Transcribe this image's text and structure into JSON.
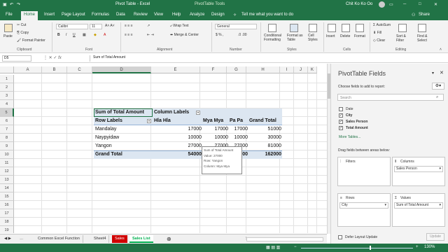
{
  "titlebar": {
    "doc_title": "Pivot Table - Excel",
    "tools_label": "PivotTable Tools",
    "user": "Chit Ko Ko Oo"
  },
  "ribbon_tabs": [
    "File",
    "Home",
    "Insert",
    "Page Layout",
    "Formulas",
    "Data",
    "Review",
    "View",
    "Help",
    "Analyze",
    "Design"
  ],
  "tell_me": "Tell me what you want to do",
  "share": "Share",
  "clipboard": {
    "paste": "Paste",
    "cut": "Cut",
    "copy": "Copy",
    "format_painter": "Format Painter",
    "group": "Clipboard"
  },
  "font": {
    "name": "Calibri",
    "size": "11",
    "group": "Font"
  },
  "alignment": {
    "wrap": "Wrap Text",
    "merge": "Merge & Center",
    "group": "Alignment"
  },
  "number": {
    "format": "General",
    "group": "Number"
  },
  "styles": {
    "conditional": "Conditional Formatting",
    "format_table": "Format as Table",
    "cell_styles": "Cell Styles",
    "group": "Styles"
  },
  "cells": {
    "insert": "Insert",
    "delete": "Delete",
    "format": "Format",
    "group": "Cells"
  },
  "editing": {
    "autosum": "AutoSum",
    "fill": "Fill",
    "clear": "Clear",
    "sort": "Sort & Filter",
    "find": "Find & Select",
    "group": "Editing"
  },
  "formula_bar": {
    "name_box": "D5",
    "formula": "Sum of Total Amount"
  },
  "columns": [
    "A",
    "B",
    "C",
    "D",
    "E",
    "F",
    "G",
    "H",
    "I",
    "J",
    "K"
  ],
  "rows": [
    "1",
    "2",
    "3",
    "4",
    "5",
    "6",
    "7",
    "8",
    "9",
    "10",
    "11",
    "12",
    "13",
    "14",
    "15",
    "16",
    "17",
    "18",
    "19"
  ],
  "pivot": {
    "sum_label": "Sum of Total Amount",
    "col_labels": "Column Labels",
    "row_labels": "Row Labels",
    "headers": [
      "Hla Hla",
      "Mya Mya",
      "Pa Pa",
      "Grand Total"
    ],
    "data_rows": [
      {
        "label": "Mandalay",
        "values": [
          "17000",
          "17000",
          "17000",
          "51000"
        ]
      },
      {
        "label": "Naypyidaw",
        "values": [
          "10000",
          "10000",
          "10000",
          "30000"
        ]
      },
      {
        "label": "Yangon",
        "values": [
          "27000",
          "27000",
          "27000",
          "81000"
        ]
      }
    ],
    "grand_total": {
      "label": "Grand Total",
      "values": [
        "54000",
        "",
        "00",
        "162000"
      ]
    }
  },
  "tooltip": {
    "line1": "Sum of Total Amount",
    "line2": "Value: 27000",
    "line3": "Row: Yangon",
    "line4": "Column: Mya Mya"
  },
  "sheet_tabs": [
    "Common Excel Function",
    "Sheet4",
    "Sales",
    "Sales List"
  ],
  "active_sheet": "Sales List",
  "pivot_panel": {
    "title": "PivotTable Fields",
    "subtitle": "Choose fields to add to report:",
    "search_placeholder": "Search",
    "fields": [
      {
        "name": "Date",
        "checked": false
      },
      {
        "name": "City",
        "checked": true
      },
      {
        "name": "Sales Person",
        "checked": true
      },
      {
        "name": "Total Amount",
        "checked": true
      }
    ],
    "more_tables": "More Tables...",
    "drag_label": "Drag fields between areas below:",
    "filters": "Filters",
    "columns": "Columns",
    "columns_item": "Sales Person",
    "rows": "Rows",
    "rows_item": "City",
    "values": "Values",
    "values_item": "Sum of Total Amount",
    "defer": "Defer Layout Update",
    "update": "Update"
  },
  "zoom": "130%",
  "colors": {
    "excel_green": "#217346",
    "pivot_header": "#dce6f1",
    "sales_tab": "#d00000",
    "sales_list_tab": "#00b050"
  }
}
